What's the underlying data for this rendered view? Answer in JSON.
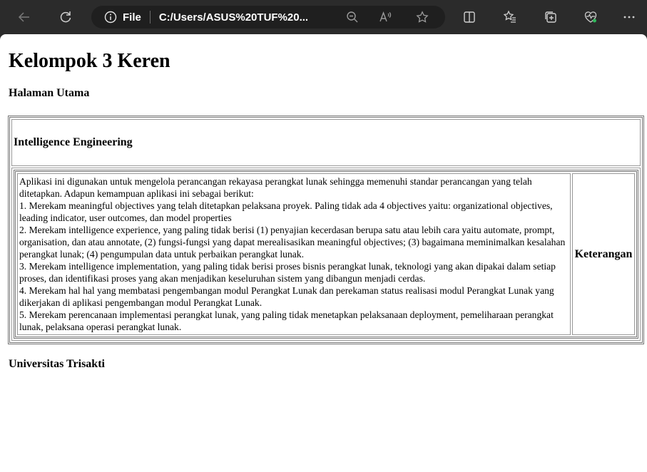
{
  "browser": {
    "file_label": "File",
    "url": "C:/Users/ASUS%20TUF%20...",
    "read_aloud_label": "A̩"
  },
  "page": {
    "title": "Kelompok 3 Keren",
    "subtitle": "Halaman Utama",
    "section_title": "Intelligence Engineering",
    "description_lines": [
      "Aplikasi ini digunakan untuk mengelola perancangan rekayasa perangkat lunak sehingga memenuhi standar perancangan yang telah ditetapkan. Adapun kemampuan aplikasi ini sebagai berikut:",
      "1. Merekam meaningful objectives yang telah ditetapkan pelaksana proyek. Paling tidak ada 4 objectives yaitu: organizational objectives, leading indicator, user outcomes, dan model properties",
      "2. Merekam intelligence experience, yang paling tidak berisi (1) penyajian kecerdasan berupa satu atau lebih cara yaitu automate, prompt, organisation, dan atau annotate, (2) fungsi-fungsi yang dapat merealisasikan meaningful objectives; (3) bagaimana meminimalkan kesalahan perangkat lunak; (4) pengumpulan data untuk perbaikan perangkat lunak.",
      "3. Merekam intelligence implementation, yang paling tidak berisi proses bisnis perangkat lunak, teknologi yang akan dipakai dalam setiap proses, dan identifikasi proses yang akan menjadikan keseluruhan sistem yang dibangun menjadi cerdas.",
      "4. Merekam hal hal yang membatasi pengembangan modul Perangkat Lunak dan perekaman status realisasi modul Perangkat Lunak yang dikerjakan di aplikasi pengembangan modul Perangkat Lunak.",
      "5. Merekam perencanaan implementasi perangkat lunak, yang paling tidak menetapkan pelaksanaan deployment, pemeliharaan perangkat lunak, pelaksana operasi perangkat lunak."
    ],
    "keterangan": "Keterangan",
    "footer": "Universitas Trisakti"
  }
}
